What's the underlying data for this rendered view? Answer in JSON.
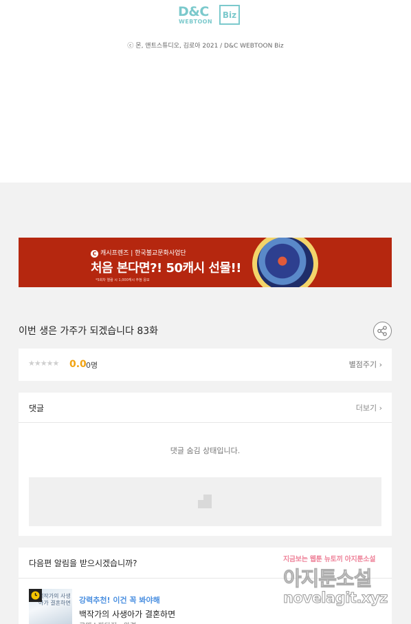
{
  "logo": {
    "text": "D&C",
    "sub": "WEBTOON",
    "badge": "Biz",
    "color": "#7bc9cc"
  },
  "copyright": "ⓒ 몬, 앤트스튜디오, 김로아 2021 / D&C WEBTOON Biz",
  "banner": {
    "brand": "캐시프렌즈 | 한국불교문화사업단",
    "brand_icon": "C",
    "headline": "처음 본다면?! 50캐시 선물!!",
    "note": "*5회차 열람 시 1,000캐시 추첨 응모",
    "bg_color": "#b5270f"
  },
  "episode": {
    "title": "이번 생은 가주가 되겠습니다 83화",
    "share_icon": "share-icon"
  },
  "rating": {
    "stars": "★★★★★",
    "score": "0.0",
    "count": "0명",
    "rate_label": "별점주기 ›",
    "score_color": "#f1a312"
  },
  "comments": {
    "title": "댓글",
    "more_label": "더보기 ›",
    "hidden_message": "댓글 숨김 상태입니다."
  },
  "next_episode": {
    "question": "다음편 알림을 받으시겠습니까?",
    "recommend_label": "강력추천! 이건 꼭 봐야해",
    "title": "백작가의 사생아가 결혼하면",
    "subtitle": "로맨스판타지 · 완결",
    "thumb_text": "백작가의 사생아가 결혼하면",
    "accent_color": "#4a8fe0"
  },
  "watermark": {
    "line1": "지금보는 웹툰 뉴토끼 아지툰소설",
    "line2": "아지툰소설",
    "line3": "novelagit.xyz"
  }
}
